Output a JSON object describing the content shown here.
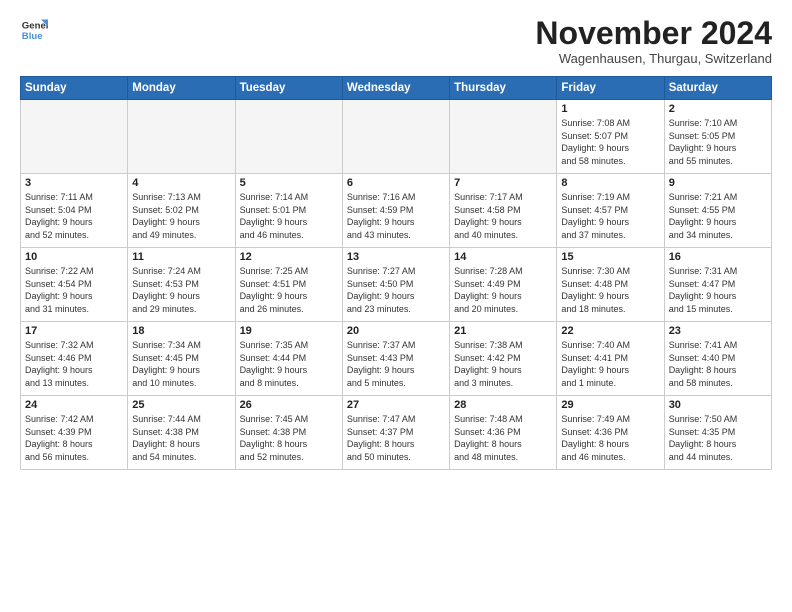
{
  "header": {
    "logo_line1": "General",
    "logo_line2": "Blue",
    "month_title": "November 2024",
    "location": "Wagenhausen, Thurgau, Switzerland"
  },
  "days_of_week": [
    "Sunday",
    "Monday",
    "Tuesday",
    "Wednesday",
    "Thursday",
    "Friday",
    "Saturday"
  ],
  "weeks": [
    [
      {
        "day": "",
        "info": ""
      },
      {
        "day": "",
        "info": ""
      },
      {
        "day": "",
        "info": ""
      },
      {
        "day": "",
        "info": ""
      },
      {
        "day": "",
        "info": ""
      },
      {
        "day": "1",
        "info": "Sunrise: 7:08 AM\nSunset: 5:07 PM\nDaylight: 9 hours\nand 58 minutes."
      },
      {
        "day": "2",
        "info": "Sunrise: 7:10 AM\nSunset: 5:05 PM\nDaylight: 9 hours\nand 55 minutes."
      }
    ],
    [
      {
        "day": "3",
        "info": "Sunrise: 7:11 AM\nSunset: 5:04 PM\nDaylight: 9 hours\nand 52 minutes."
      },
      {
        "day": "4",
        "info": "Sunrise: 7:13 AM\nSunset: 5:02 PM\nDaylight: 9 hours\nand 49 minutes."
      },
      {
        "day": "5",
        "info": "Sunrise: 7:14 AM\nSunset: 5:01 PM\nDaylight: 9 hours\nand 46 minutes."
      },
      {
        "day": "6",
        "info": "Sunrise: 7:16 AM\nSunset: 4:59 PM\nDaylight: 9 hours\nand 43 minutes."
      },
      {
        "day": "7",
        "info": "Sunrise: 7:17 AM\nSunset: 4:58 PM\nDaylight: 9 hours\nand 40 minutes."
      },
      {
        "day": "8",
        "info": "Sunrise: 7:19 AM\nSunset: 4:57 PM\nDaylight: 9 hours\nand 37 minutes."
      },
      {
        "day": "9",
        "info": "Sunrise: 7:21 AM\nSunset: 4:55 PM\nDaylight: 9 hours\nand 34 minutes."
      }
    ],
    [
      {
        "day": "10",
        "info": "Sunrise: 7:22 AM\nSunset: 4:54 PM\nDaylight: 9 hours\nand 31 minutes."
      },
      {
        "day": "11",
        "info": "Sunrise: 7:24 AM\nSunset: 4:53 PM\nDaylight: 9 hours\nand 29 minutes."
      },
      {
        "day": "12",
        "info": "Sunrise: 7:25 AM\nSunset: 4:51 PM\nDaylight: 9 hours\nand 26 minutes."
      },
      {
        "day": "13",
        "info": "Sunrise: 7:27 AM\nSunset: 4:50 PM\nDaylight: 9 hours\nand 23 minutes."
      },
      {
        "day": "14",
        "info": "Sunrise: 7:28 AM\nSunset: 4:49 PM\nDaylight: 9 hours\nand 20 minutes."
      },
      {
        "day": "15",
        "info": "Sunrise: 7:30 AM\nSunset: 4:48 PM\nDaylight: 9 hours\nand 18 minutes."
      },
      {
        "day": "16",
        "info": "Sunrise: 7:31 AM\nSunset: 4:47 PM\nDaylight: 9 hours\nand 15 minutes."
      }
    ],
    [
      {
        "day": "17",
        "info": "Sunrise: 7:32 AM\nSunset: 4:46 PM\nDaylight: 9 hours\nand 13 minutes."
      },
      {
        "day": "18",
        "info": "Sunrise: 7:34 AM\nSunset: 4:45 PM\nDaylight: 9 hours\nand 10 minutes."
      },
      {
        "day": "19",
        "info": "Sunrise: 7:35 AM\nSunset: 4:44 PM\nDaylight: 9 hours\nand 8 minutes."
      },
      {
        "day": "20",
        "info": "Sunrise: 7:37 AM\nSunset: 4:43 PM\nDaylight: 9 hours\nand 5 minutes."
      },
      {
        "day": "21",
        "info": "Sunrise: 7:38 AM\nSunset: 4:42 PM\nDaylight: 9 hours\nand 3 minutes."
      },
      {
        "day": "22",
        "info": "Sunrise: 7:40 AM\nSunset: 4:41 PM\nDaylight: 9 hours\nand 1 minute."
      },
      {
        "day": "23",
        "info": "Sunrise: 7:41 AM\nSunset: 4:40 PM\nDaylight: 8 hours\nand 58 minutes."
      }
    ],
    [
      {
        "day": "24",
        "info": "Sunrise: 7:42 AM\nSunset: 4:39 PM\nDaylight: 8 hours\nand 56 minutes."
      },
      {
        "day": "25",
        "info": "Sunrise: 7:44 AM\nSunset: 4:38 PM\nDaylight: 8 hours\nand 54 minutes."
      },
      {
        "day": "26",
        "info": "Sunrise: 7:45 AM\nSunset: 4:38 PM\nDaylight: 8 hours\nand 52 minutes."
      },
      {
        "day": "27",
        "info": "Sunrise: 7:47 AM\nSunset: 4:37 PM\nDaylight: 8 hours\nand 50 minutes."
      },
      {
        "day": "28",
        "info": "Sunrise: 7:48 AM\nSunset: 4:36 PM\nDaylight: 8 hours\nand 48 minutes."
      },
      {
        "day": "29",
        "info": "Sunrise: 7:49 AM\nSunset: 4:36 PM\nDaylight: 8 hours\nand 46 minutes."
      },
      {
        "day": "30",
        "info": "Sunrise: 7:50 AM\nSunset: 4:35 PM\nDaylight: 8 hours\nand 44 minutes."
      }
    ]
  ]
}
